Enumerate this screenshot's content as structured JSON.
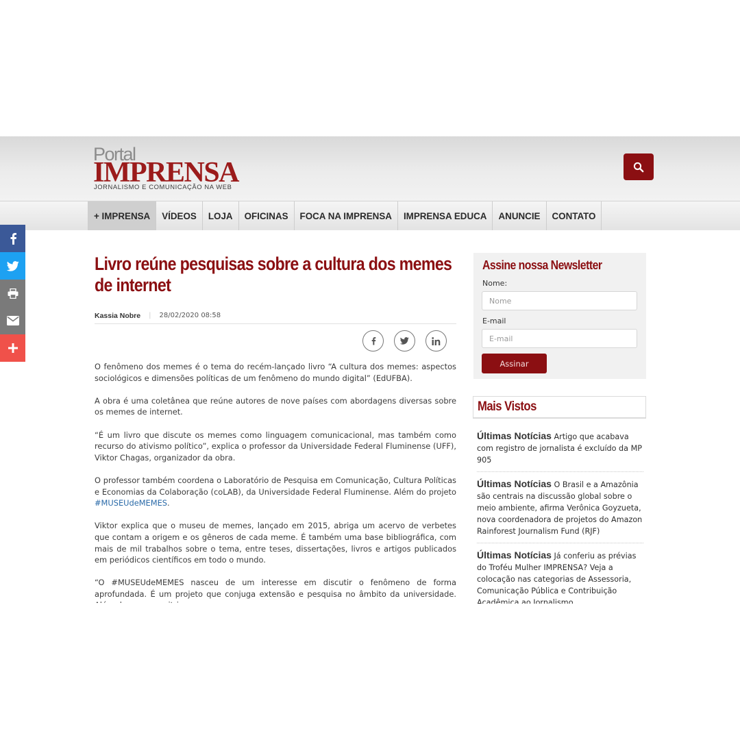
{
  "brand": {
    "portal": "Portal",
    "name": "IMPRENSA",
    "tagline": "JORNALISMO E COMUNICAÇÃO NA WEB"
  },
  "colors": {
    "brand_red": "#8b0f12",
    "link_blue": "#2a6aa8"
  },
  "header": {
    "search_icon": "search-icon"
  },
  "nav": {
    "items": [
      {
        "label": "+ IMPRENSA"
      },
      {
        "label": "VÍDEOS"
      },
      {
        "label": "LOJA"
      },
      {
        "label": "OFICINAS"
      },
      {
        "label": "FOCA NA IMPRENSA"
      },
      {
        "label": "IMPRENSA EDUCA"
      },
      {
        "label": "ANUNCIE"
      },
      {
        "label": "CONTATO"
      }
    ]
  },
  "share_rail": [
    {
      "icon": "facebook-icon",
      "color": "#3b5998"
    },
    {
      "icon": "twitter-icon",
      "color": "#1da1f2"
    },
    {
      "icon": "print-icon",
      "color": "#7a7a7a"
    },
    {
      "icon": "email-icon",
      "color": "#7a7a7a"
    },
    {
      "icon": "plus-icon",
      "color": "#f0514a"
    }
  ],
  "article": {
    "title": "Livro reúne pesquisas sobre a cultura dos memes de internet",
    "author": "Kassia Nobre",
    "datetime": "28/02/2020 08:58",
    "share_icons": [
      "facebook-icon",
      "twitter-icon",
      "linkedin-icon"
    ],
    "paragraphs": {
      "p1": "O fenômeno dos memes é o tema do recém-lançado livro “A cultura dos memes: aspectos sociológicos e dimensões políticas de um fenômeno do mundo digital” (EdUFBA).",
      "p2": "A obra é uma coletânea que reúne autores de nove países com abordagens diversas sobre os memes de internet.",
      "p3": "“É um livro que discute os memes como linguagem comunicacional, mas também como recurso do ativismo político”, explica o professor da Universidade Federal Fluminense (UFF), Viktor Chagas, organizador da obra.",
      "p4_before": "O professor também coordena o Laboratório de Pesquisa em Comunicação, Cultura Políticas e Economias da Colaboração (coLAB), da Universidade Federal Fluminense. Além do projeto ",
      "p4_link": "#MUSEUdeMEMES",
      "p4_after": ".",
      "p5": "Viktor explica que o museu de memes, lançado em 2015, abriga um acervo de verbetes que contam a origem e os gêneros de cada meme. É também uma base bibliográfica, com mais de mil trabalhos sobre o tema, entre teses, dissertações, livros e artigos publicados em periódicos científicos em todo o mundo.",
      "p6": " “O #MUSEUdeMEMES nasceu de um interesse em discutir o fenômeno de forma aprofundada. É um projeto que conjuga extensão e pesquisa no âmbito da universidade. Além de ser uma vitrine"
    }
  },
  "newsletter": {
    "title": "Assine nossa Newsletter",
    "name_label": "Nome:",
    "name_placeholder": "Nome",
    "email_label": "E-mail",
    "email_placeholder": "E-mail",
    "submit_label": "Assinar"
  },
  "mais_vistos": {
    "title": "Mais Vistos",
    "items": [
      {
        "category": "Últimas Notícias",
        "text": "Artigo que acabava com registro de jornalista é excluído da MP 905"
      },
      {
        "category": "Últimas Notícias",
        "text": "O Brasil e a Amazônia são centrais na discussão global sobre o meio ambiente, afirma Verônica Goyzueta, nova coordenadora de projetos do Amazon Rainforest Journalism Fund (RJF)"
      },
      {
        "category": "Últimas Notícias",
        "text": "Já conferiu as prévias do Troféu Mulher IMPRENSA? Veja a colocação nas categorias de Assessoria, Comunicação Pública e Contribuição Acadêmica ao Jornalismo"
      }
    ]
  }
}
